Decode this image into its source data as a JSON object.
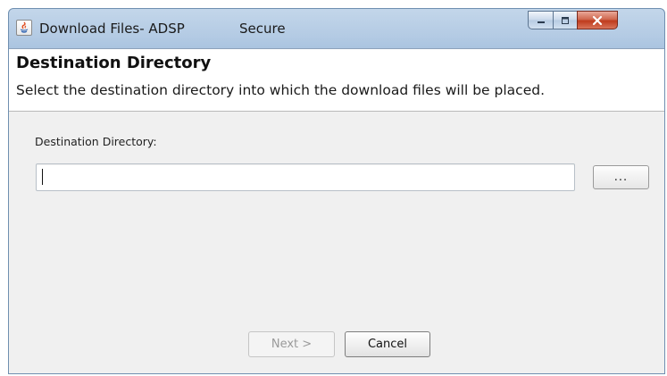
{
  "window": {
    "title": "Download Files- ADSP",
    "secure_label": "Secure",
    "controls": {
      "minimize": "minimize-icon",
      "maximize": "maximize-icon",
      "close": "close-icon"
    }
  },
  "header": {
    "title": "Destination Directory",
    "description": "Select the destination directory into which the download files will be placed."
  },
  "form": {
    "destination_label": "Destination Directory:",
    "destination_value": "",
    "browse_label": "..."
  },
  "footer": {
    "next_label": "Next >",
    "next_enabled": false,
    "cancel_label": "Cancel"
  },
  "colors": {
    "titlebar": "#b4cbe4",
    "close_button": "#c8472a",
    "content_bg": "#f0f0f0",
    "header_bg": "#ffffff"
  }
}
